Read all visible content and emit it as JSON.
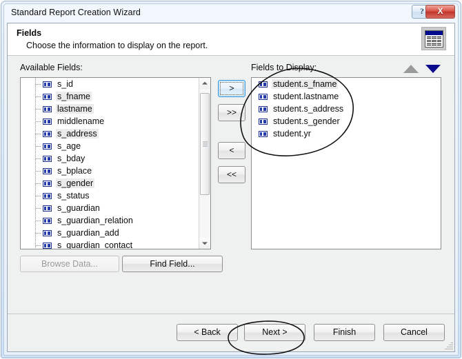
{
  "window": {
    "title": "Standard Report Creation Wizard",
    "help_label": "?",
    "close_label": "X"
  },
  "header": {
    "title": "Fields",
    "subtitle": "Choose the information to display on the report.",
    "icon": "report-table-icon"
  },
  "available_fields": {
    "label": "Available Fields:",
    "items": [
      {
        "name": "s_id",
        "selected": false
      },
      {
        "name": "s_fname",
        "selected": true
      },
      {
        "name": "lastname",
        "selected": true
      },
      {
        "name": "middlename",
        "selected": false
      },
      {
        "name": "s_address",
        "selected": true
      },
      {
        "name": "s_age",
        "selected": false
      },
      {
        "name": "s_bday",
        "selected": false
      },
      {
        "name": "s_bplace",
        "selected": false
      },
      {
        "name": "s_gender",
        "selected": true
      },
      {
        "name": "s_status",
        "selected": false
      },
      {
        "name": "s_guardian",
        "selected": false
      },
      {
        "name": "s_guardian_relation",
        "selected": false
      },
      {
        "name": "s_guardian_add",
        "selected": false
      },
      {
        "name": "s_guardian_contact",
        "selected": false
      }
    ],
    "scrollbar": {
      "up_icon": "scroll-up-arrow-icon",
      "down_icon": "scroll-down-arrow-icon"
    }
  },
  "fields_to_display": {
    "label": "Fields to Display:",
    "items": [
      {
        "name": "student.s_fname",
        "selected": true
      },
      {
        "name": "student.lastname",
        "selected": false
      },
      {
        "name": "student.s_address",
        "selected": false
      },
      {
        "name": "student.s_gender",
        "selected": false
      },
      {
        "name": "student.yr",
        "selected": false
      }
    ],
    "sort_up_icon": "sort-up-arrow-icon",
    "sort_down_icon": "sort-down-arrow-icon",
    "sort_up_color": "#9a9a9a",
    "sort_down_color": "#0a0a8c"
  },
  "transfer_buttons": {
    "add": ">",
    "add_all": ">>",
    "remove": "<",
    "remove_all": "<<"
  },
  "data_buttons": {
    "browse": "Browse Data...",
    "find": "Find Field..."
  },
  "footer": {
    "back": "< Back",
    "next": "Next >",
    "finish": "Finish",
    "cancel": "Cancel"
  },
  "annotations": [
    {
      "name": "fields-to-display-highlight",
      "shape": "ellipse"
    },
    {
      "name": "next-button-highlight",
      "shape": "ellipse"
    }
  ],
  "colors": {
    "accent": "#0a0a8c",
    "close_red": "#c0352b",
    "focus_blue": "#3c9adc",
    "window_chrome": "#cfe0f4"
  }
}
